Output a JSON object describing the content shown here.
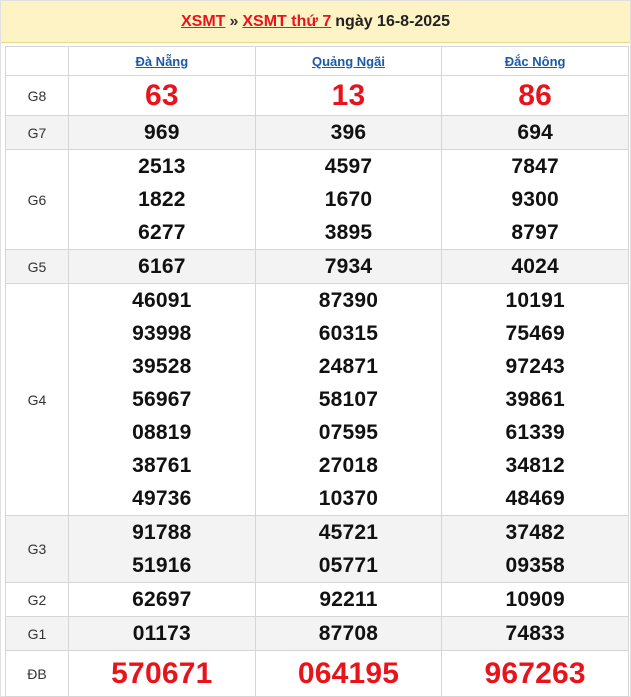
{
  "header": {
    "link1": "XSMT",
    "separator": "»",
    "link2": "XSMT thứ 7",
    "date_text": "ngày 16-8-2025"
  },
  "provinces": [
    "Đà Nẵng",
    "Quảng Ngãi",
    "Đắc Nông"
  ],
  "prizes": [
    {
      "label": "G8",
      "values": [
        [
          "63"
        ],
        [
          "13"
        ],
        [
          "86"
        ]
      ]
    },
    {
      "label": "G7",
      "values": [
        [
          "969"
        ],
        [
          "396"
        ],
        [
          "694"
        ]
      ]
    },
    {
      "label": "G6",
      "values": [
        [
          "2513",
          "1822",
          "6277"
        ],
        [
          "4597",
          "1670",
          "3895"
        ],
        [
          "7847",
          "9300",
          "8797"
        ]
      ]
    },
    {
      "label": "G5",
      "values": [
        [
          "6167"
        ],
        [
          "7934"
        ],
        [
          "4024"
        ]
      ]
    },
    {
      "label": "G4",
      "values": [
        [
          "46091",
          "93998",
          "39528",
          "56967",
          "08819",
          "38761",
          "49736"
        ],
        [
          "87390",
          "60315",
          "24871",
          "58107",
          "07595",
          "27018",
          "10370"
        ],
        [
          "10191",
          "75469",
          "97243",
          "39861",
          "61339",
          "34812",
          "48469"
        ]
      ]
    },
    {
      "label": "G3",
      "values": [
        [
          "91788",
          "51916"
        ],
        [
          "45721",
          "05771"
        ],
        [
          "37482",
          "09358"
        ]
      ]
    },
    {
      "label": "G2",
      "values": [
        [
          "62697"
        ],
        [
          "92211"
        ],
        [
          "10909"
        ]
      ]
    },
    {
      "label": "G1",
      "values": [
        [
          "01173"
        ],
        [
          "87708"
        ],
        [
          "74833"
        ]
      ]
    },
    {
      "label": "ĐB",
      "values": [
        [
          "570671"
        ],
        [
          "064195"
        ],
        [
          "967263"
        ]
      ]
    }
  ],
  "colors": {
    "accent_red": "#e8141c",
    "link_blue": "#1a5aa6",
    "header_bg": "#fdf3c4"
  }
}
